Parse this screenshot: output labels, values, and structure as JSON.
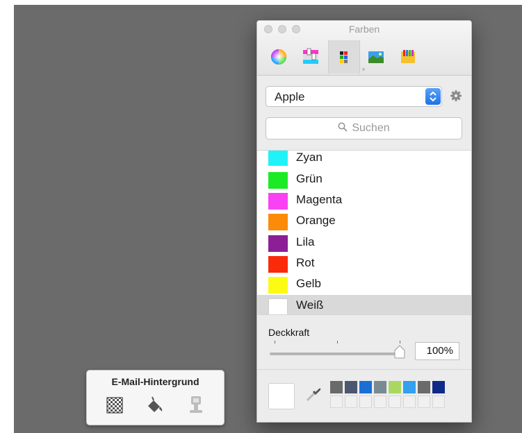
{
  "colors_panel": {
    "title": "Farben",
    "modes": [
      {
        "icon": "color-wheel-icon",
        "active": false
      },
      {
        "icon": "color-sliders-icon",
        "active": false
      },
      {
        "icon": "color-palettes-icon",
        "active": true
      },
      {
        "icon": "image-palettes-icon",
        "active": false
      },
      {
        "icon": "pencils-icon",
        "active": false
      }
    ],
    "palette_popup": {
      "value": "Apple"
    },
    "search": {
      "placeholder": "Suchen"
    },
    "colors": [
      {
        "name": "Zyan",
        "hex": "#1ff3f7",
        "selected": false
      },
      {
        "name": "Grün",
        "hex": "#1aeb24",
        "selected": false
      },
      {
        "name": "Magenta",
        "hex": "#f942f4",
        "selected": false
      },
      {
        "name": "Orange",
        "hex": "#fc8b09",
        "selected": false
      },
      {
        "name": "Lila",
        "hex": "#8d1f96",
        "selected": false
      },
      {
        "name": "Rot",
        "hex": "#fb2a0a",
        "selected": false
      },
      {
        "name": "Gelb",
        "hex": "#fdfb13",
        "selected": false
      },
      {
        "name": "Weiß",
        "hex": "#ffffff",
        "selected": true
      }
    ],
    "opacity": {
      "label": "Deckkraft",
      "value_text": "100%",
      "value": 1.0
    },
    "current_color": "#ffffff",
    "swatch_wells": [
      "#6a6a6a",
      "#4c5870",
      "#1b6ed6",
      "#7a8a93",
      "#a8d860",
      "#33a0f0",
      "#6b6b6b",
      "#102a8a"
    ]
  },
  "mail_background": {
    "title": "E-Mail-Hintergrund",
    "buttons": [
      "checkerboard-icon",
      "paint-bucket-icon",
      "image-stamp-icon"
    ]
  }
}
